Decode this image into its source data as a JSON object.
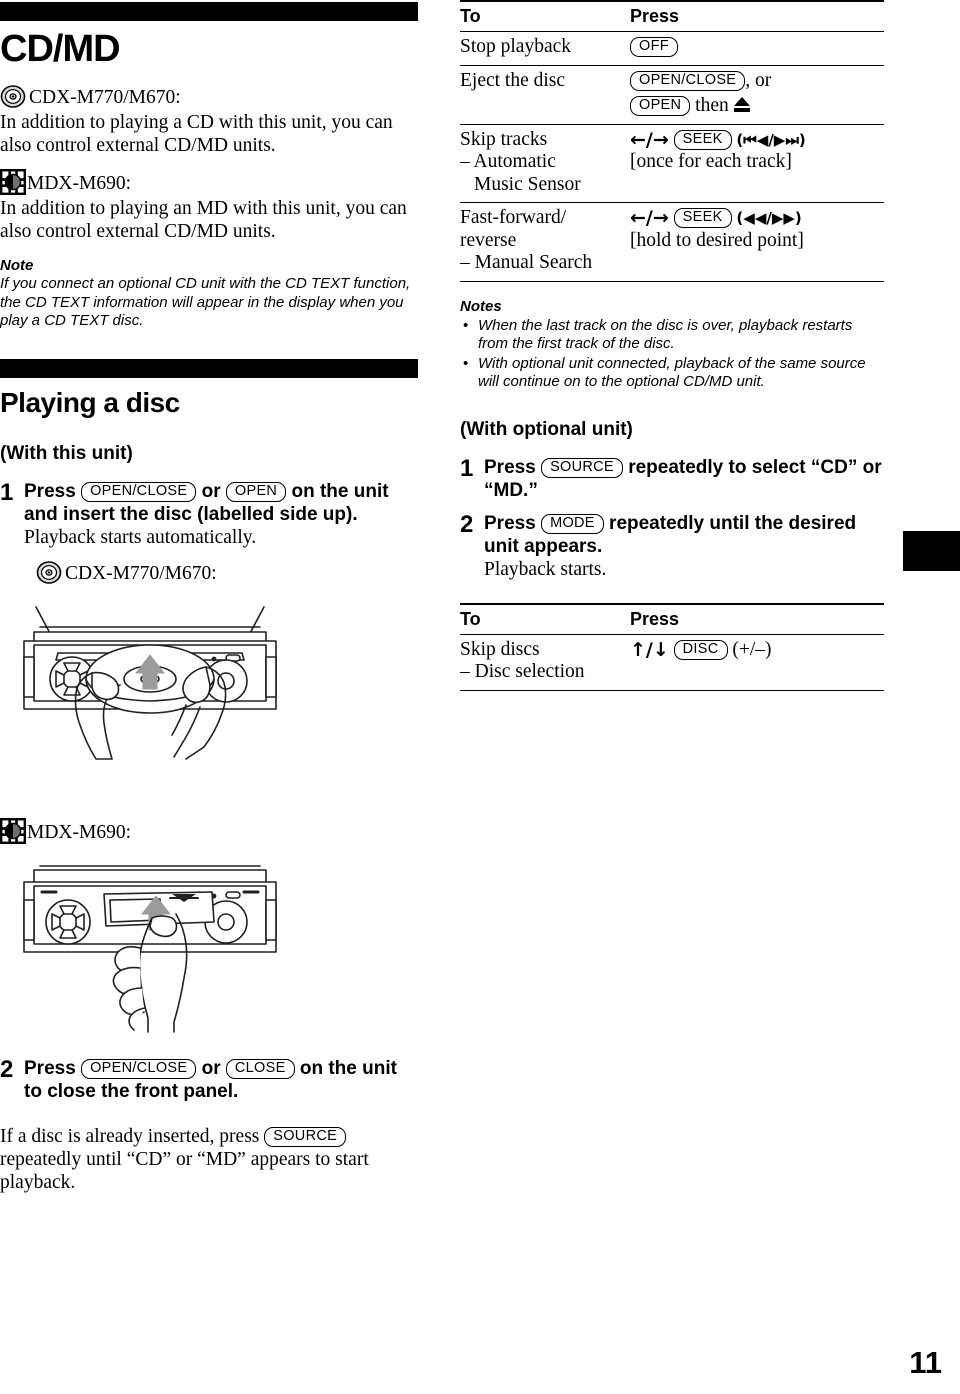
{
  "document": {
    "chapter_title": "CD/MD",
    "page_number": "11"
  },
  "left_column": {
    "cd_model_label": "CDX-M770/M670:",
    "cd_model_text": "In addition to playing a CD with this unit, you can also control external CD/MD units.",
    "md_model_label": "MDX-M690:",
    "md_model_text": "In addition to playing an MD with this unit, you can also control external CD/MD units.",
    "note_heading": "Note",
    "note_text": "If you connect an optional CD unit with the CD TEXT function, the CD TEXT information will appear in the display when you play a CD TEXT disc.",
    "section_title": "Playing a disc",
    "subhead_with_this_unit": "(With this unit)",
    "step1": {
      "number": "1",
      "press_label": "Press",
      "key_open_close": "OPEN/CLOSE",
      "or_label": "or",
      "key_open": "OPEN",
      "trailing": "on the unit and insert the disc (labelled side up).",
      "sub": "Playback starts automatically."
    },
    "figure1_caption": "CDX-M770/M670:",
    "figure2_caption": "MDX-M690:",
    "step2": {
      "number": "2",
      "press_label": "Press",
      "key_open_close": "OPEN/CLOSE",
      "or_label": "or",
      "key_close": "CLOSE",
      "trailing": "on the unit to close the front panel."
    },
    "closing_paragraph": {
      "before": "If a disc is already inserted, press",
      "key_source": "SOURCE",
      "after": "repeatedly until “CD” or “MD” appears to start playback."
    }
  },
  "right_column": {
    "table_main": {
      "headers": [
        "To",
        "Press"
      ],
      "rows": [
        {
          "to": "Stop playback",
          "to_sub1": "",
          "to_sub2": "",
          "press_keys": [
            "OFF"
          ],
          "press_prefix": "",
          "press_suffix": "",
          "press_line2": ""
        },
        {
          "to": "Eject the disc",
          "to_sub1": "",
          "to_sub2": "",
          "press_keys": [
            "OPEN/CLOSE",
            "OPEN"
          ],
          "press_prefix": "",
          "press_suffix": ", or",
          "press_line2": "then"
        },
        {
          "to": "Skip tracks",
          "to_sub1": "– Automatic",
          "to_sub2": "Music Sensor",
          "press_keys": [
            "SEEK"
          ],
          "press_arrows": "←/→",
          "press_suffix": "(⏮◀/▶⏭)",
          "press_line2": "[once for each track]"
        },
        {
          "to": "Fast-forward/",
          "to_sub1": "reverse",
          "to_sub2": "– Manual Search",
          "press_keys": [
            "SEEK"
          ],
          "press_arrows": "←/→",
          "press_suffix": "(◀◀/▶▶)",
          "press_line2": "[hold to desired point]"
        }
      ]
    },
    "notes_heading": "Notes",
    "notes": [
      "When the last track on the disc is over, playback restarts from the first track of the disc.",
      "With optional unit connected, playback of the same source will continue on to the optional CD/MD unit."
    ],
    "subhead_with_optional_unit": "(With optional unit)",
    "step1": {
      "number": "1",
      "press_label": "Press",
      "key_source": "SOURCE",
      "trailing": "repeatedly to select “CD” or “MD.”"
    },
    "step2": {
      "number": "2",
      "press_label": "Press",
      "key_mode": "MODE",
      "trailing": "repeatedly until the desired unit appears.",
      "sub": "Playback starts."
    },
    "table_disc": {
      "headers": [
        "To",
        "Press"
      ],
      "rows": [
        {
          "to": "Skip discs",
          "to_sub1": "– Disc selection",
          "press_arrows": "↑/↓",
          "press_keys": [
            "DISC"
          ],
          "press_suffix": "(+/–)"
        }
      ]
    }
  },
  "colors": {
    "ink": "#000000",
    "paper": "#ffffff"
  }
}
